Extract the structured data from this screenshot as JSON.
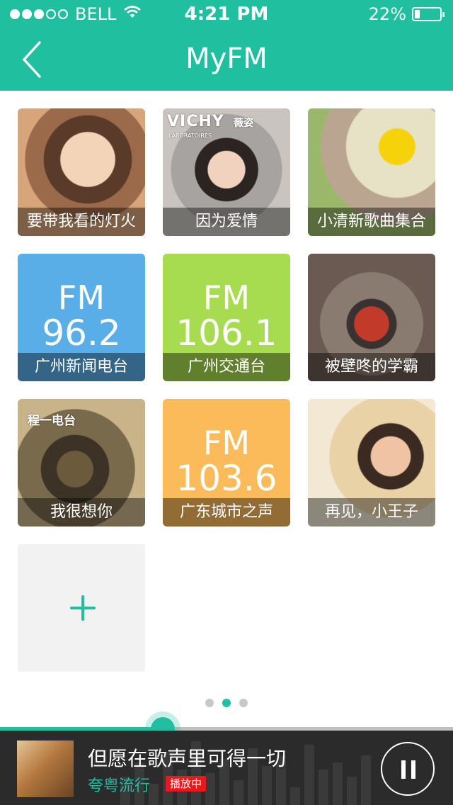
{
  "status_bar": {
    "carrier": "BELL",
    "signal_bars": 3,
    "signal_total": 5,
    "time": "4:21 PM",
    "battery": "22%",
    "battery_level": 0.22
  },
  "header": {
    "title": "MyFM",
    "background": "#1fbf9f"
  },
  "stations": [
    {
      "caption": "要带我看的灯火",
      "type": "photo"
    },
    {
      "caption": "因为爱情",
      "type": "photo",
      "overlay_brand": "VICHY",
      "overlay_cn": "薇姿",
      "overlay_sub": "LABORATOIRES"
    },
    {
      "caption": "小清新歌曲集合",
      "type": "photo"
    },
    {
      "caption": "广州新闻电台",
      "type": "fm",
      "fm_label": "FM",
      "freq": "96.2",
      "color": "#5aaee8"
    },
    {
      "caption": "广州交通台",
      "type": "fm",
      "fm_label": "FM",
      "freq": "106.1",
      "color": "#a8dc50"
    },
    {
      "caption": "被壁咚的学霸",
      "type": "photo"
    },
    {
      "caption": "我很想你",
      "type": "photo",
      "overlay_text": "程一电台"
    },
    {
      "caption": "广东城市之声",
      "type": "fm",
      "fm_label": "FM",
      "freq": "103.6",
      "color": "#fbbb5a"
    },
    {
      "caption": "再见，小王子",
      "type": "photo"
    }
  ],
  "add_tile": {
    "icon": "plus-icon",
    "accent": "#1fbf9f"
  },
  "pager": {
    "pages": 3,
    "active": 2
  },
  "player": {
    "song": "但愿在歌声里可得一切",
    "artist": "夸粤流行",
    "status_badge": "播放中",
    "progress": 0.36,
    "control_icon": "pause-icon",
    "accent": "#1fbf9f",
    "badge_color": "#e8191c"
  }
}
